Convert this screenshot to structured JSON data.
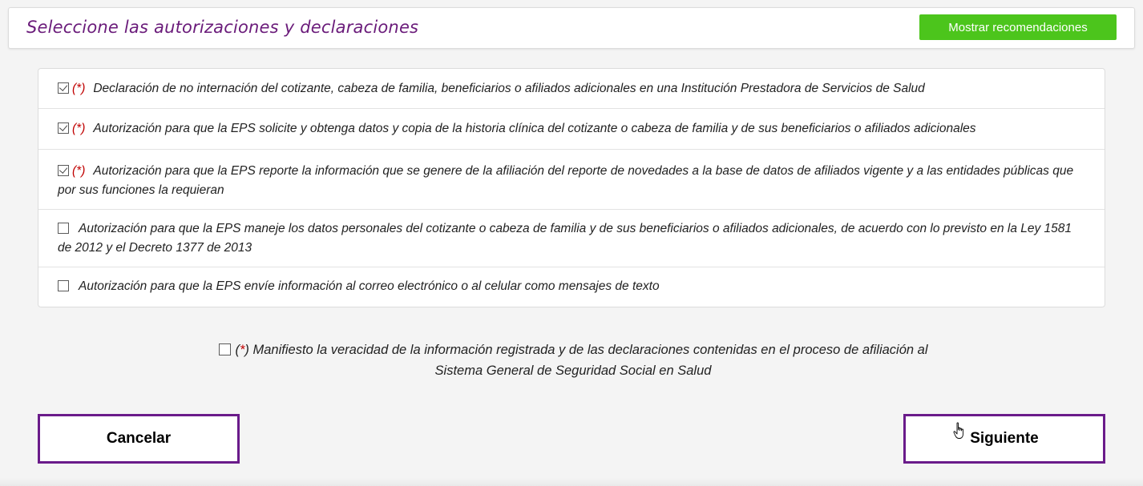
{
  "header": {
    "title": "Seleccione las autorizaciones y declaraciones",
    "recommend_button": "Mostrar recomendaciones"
  },
  "required_marker": "(*)",
  "items": [
    {
      "checked": true,
      "required": true,
      "text": "Declaración de no internación del cotizante, cabeza de familia, beneficiarios o afiliados adicionales en una Institución Prestadora de Servicios de Salud"
    },
    {
      "checked": true,
      "required": true,
      "text": "Autorización para que la EPS solicite y obtenga datos y copia de la historia clínica del cotizante o cabeza de familia y de sus beneficiarios o afiliados adicionales"
    },
    {
      "checked": true,
      "required": true,
      "text": "Autorización para que la EPS reporte la información que se genere de la afiliación del reporte de novedades a la base de datos de afiliados vigente y a las entidades públicas que por sus funciones la requieran"
    },
    {
      "checked": false,
      "required": false,
      "text": "Autorización para que la EPS maneje los datos personales del cotizante o cabeza de familia y de sus beneficiarios o afiliados adicionales, de acuerdo con lo previsto en la Ley 1581 de 2012 y el Decreto 1377 de 2013"
    },
    {
      "checked": false,
      "required": false,
      "text": "Autorización para que la EPS envíe información al correo electrónico o al celular como mensajes de texto"
    }
  ],
  "final_declaration": {
    "checked": false,
    "required_open": "(",
    "required_star": "*",
    "required_close": ")",
    "text": "Manifiesto la veracidad de la información registrada y de las declaraciones contenidas en el proceso de afiliación al Sistema General de Seguridad Social en Salud"
  },
  "buttons": {
    "cancel": "Cancelar",
    "next": "Siguiente"
  },
  "colors": {
    "title": "#6a1b7a",
    "recommend_bg": "#4cc51c",
    "button_border": "#6a1b8a",
    "required": "#c00000"
  }
}
